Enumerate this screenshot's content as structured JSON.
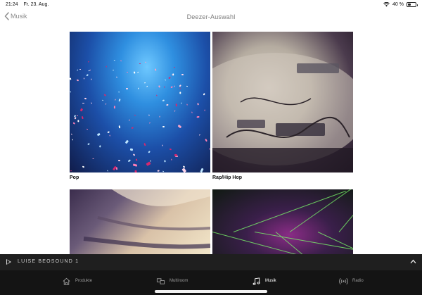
{
  "status_bar": {
    "time": "21:24",
    "date": "Fr. 23. Aug.",
    "battery_text": "40 %",
    "battery_level": 0.4
  },
  "nav": {
    "back_label": "Musik",
    "title": "Deezer-Auswahl"
  },
  "genres": [
    {
      "label": "Pop"
    },
    {
      "label": "Rap/Hip Hop"
    },
    {
      "label": ""
    },
    {
      "label": ""
    }
  ],
  "player": {
    "device_name": "LUISE BEOSOUND 1"
  },
  "tabs": [
    {
      "label": "Produkte",
      "icon": "home-icon",
      "active": false
    },
    {
      "label": "Multiroom",
      "icon": "multiroom-icon",
      "active": false
    },
    {
      "label": "Musik",
      "icon": "music-note-icon",
      "active": true
    },
    {
      "label": "Radio",
      "icon": "radio-icon",
      "active": false
    }
  ]
}
